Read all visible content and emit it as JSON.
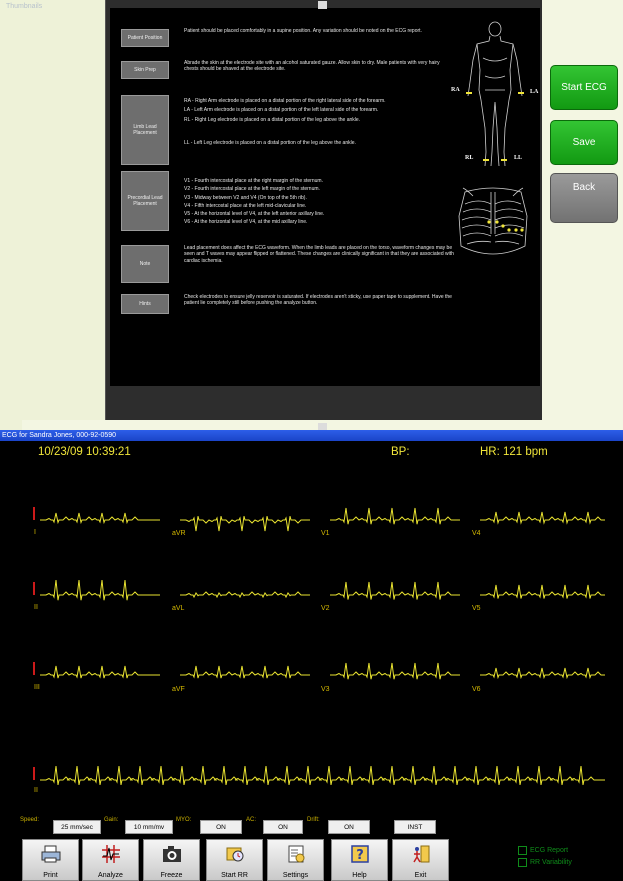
{
  "top_app": {
    "thumbnails_label": "Thumbnails",
    "rows": [
      {
        "button": "Patient Position",
        "text": [
          "Patient should be placed comfortably in a supine position. Any variation should be noted on the ECG report."
        ]
      },
      {
        "button": "Skin Prep",
        "text": [
          "Abrade the skin at the electrode site with an alcohol saturated gauze. Allow skin to dry. Male patients with very hairy chests should be shaved at the electrode site."
        ]
      },
      {
        "button": "Limb Lead Placement",
        "text": [
          "RA - Right Arm electrode is placed on a distal portion of the right lateral side of the forearm.",
          "LA - Left Arm electrode is placed on a distal portion of the left lateral side of the forearm.",
          "RL - Right Leg electrode is placed on a distal portion of the leg above the ankle.",
          "LL - Left Leg electrode is placed on a distal portion of the leg above the ankle."
        ]
      },
      {
        "button": "Precordial Lead Placement",
        "text": [
          "V1 - Fourth intercostal place at the right margin of the sternum.",
          "V2 - Fourth intercostal place at the left margin of the sternum.",
          "V3 - Midway between V2 and V4 (On top of the 5th rib).",
          "V4 - Fifth intercostal place at the left mid-clavicular line.",
          "V5 - At the horizontal level of V4, at the left anterior axillary line.",
          "V6 - At the horizontal level of V4, at the mid axillary line."
        ]
      },
      {
        "button": "Note",
        "text": [
          "Lead placement does affect the ECG waveform. When the limb leads are placed on the torso, waveform changes may be seen and T waves may appear flipped or flattened. These changes are clinically significant in that they are associated with cardiac ischemia."
        ]
      },
      {
        "button": "Hints",
        "text": [
          "Check electrodes to ensure jelly reservoir is saturated. If electrodes aren't sticky, use paper tape to supplement. Have the patient lie completely still before pushing the analyze button."
        ]
      }
    ],
    "figure_labels": {
      "ra": "RA",
      "la": "LA",
      "rl": "RL",
      "ll": "LL"
    },
    "side_buttons": {
      "start_ecg": "Start ECG",
      "save": "Save",
      "back": "Back"
    }
  },
  "ecg": {
    "title": "ECG for Sandra Jones, 000-92-0590",
    "datetime": "10/23/09 10:39:21",
    "bp_label": "BP:",
    "hr_text": "HR:  121 bpm",
    "leads": {
      "row1": [
        "I",
        "aVR",
        "V1",
        "V4"
      ],
      "row2": [
        "II",
        "aVL",
        "V2",
        "V5"
      ],
      "row3": [
        "III",
        "aVF",
        "V3",
        "V6"
      ],
      "rhythm": "II"
    },
    "settings": {
      "speed_label": "Speed:",
      "speed_value": "25 mm/sec",
      "gain_label": "Gain:",
      "gain_value": "10 mm/mv",
      "myo_label": "MYO:",
      "myo_value": "ON",
      "ac_label": "AC:",
      "ac_value": "ON",
      "drift_label": "Drift:",
      "drift_value": "ON",
      "inst_value": "INST"
    },
    "toolbar": [
      "Print",
      "Analyze",
      "Freeze",
      "Start RR",
      "Settings",
      "Help",
      "Exit"
    ],
    "report_options": [
      "ECG Report",
      "RR Variability"
    ],
    "colors": {
      "trace": "#e8e230",
      "label": "#d5b900",
      "calibration": "#cc1a1a",
      "titlebar": "#1a44c8"
    }
  }
}
